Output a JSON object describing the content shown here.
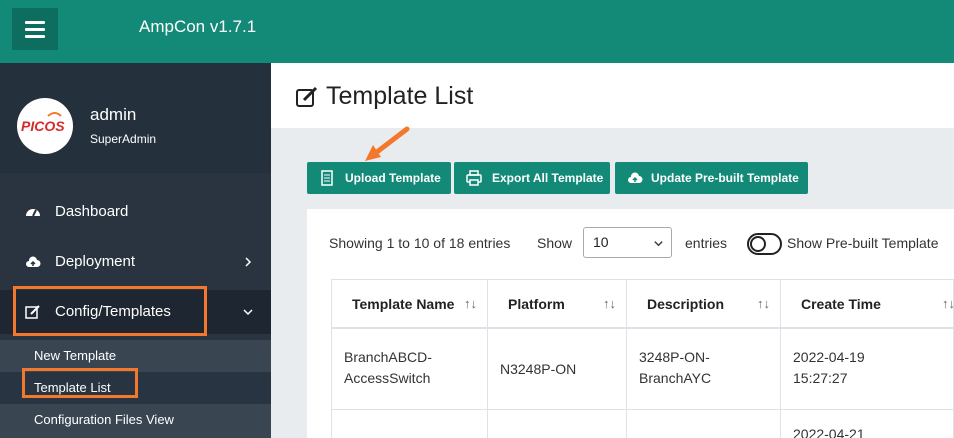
{
  "app": {
    "title": "AmpCon v1.7.1"
  },
  "user": {
    "name": "admin",
    "role": "SuperAdmin",
    "avatar_text": "PICOS"
  },
  "sidebar": {
    "items": [
      {
        "label": "Dashboard",
        "icon": "dashboard-icon"
      },
      {
        "label": "Deployment",
        "icon": "cloud-icon"
      },
      {
        "label": "Config/Templates",
        "icon": "edit-icon"
      }
    ],
    "submenu": [
      {
        "label": "New Template"
      },
      {
        "label": "Template List"
      },
      {
        "label": "Configuration Files View"
      }
    ]
  },
  "page": {
    "title": "Template List"
  },
  "toolbar": {
    "upload_label": "Upload Template",
    "export_label": "Export All Template",
    "update_label": "Update Pre-built Template"
  },
  "list": {
    "entries_info": "Showing 1 to 10 of 18 entries",
    "show_label": "Show",
    "page_size": "10",
    "entries_label": "entries",
    "toggle_label": "Show Pre-built Template"
  },
  "table": {
    "columns": [
      "Template Name",
      "Platform",
      "Description",
      "Create Time"
    ],
    "sort_glyph": "↑↓",
    "rows": [
      {
        "name": "BranchABCD-\nAccessSwitch",
        "platform": "N3248P-ON",
        "description": "3248P-ON-\nBranchAYC",
        "create_time": "2022-04-19\n15:27:27"
      },
      {
        "name": "",
        "platform": "",
        "description": "",
        "create_time": "2022-04-21"
      }
    ]
  },
  "colors": {
    "accent": "#138a77",
    "sidebar": "#293440",
    "highlight": "#f4782b"
  }
}
